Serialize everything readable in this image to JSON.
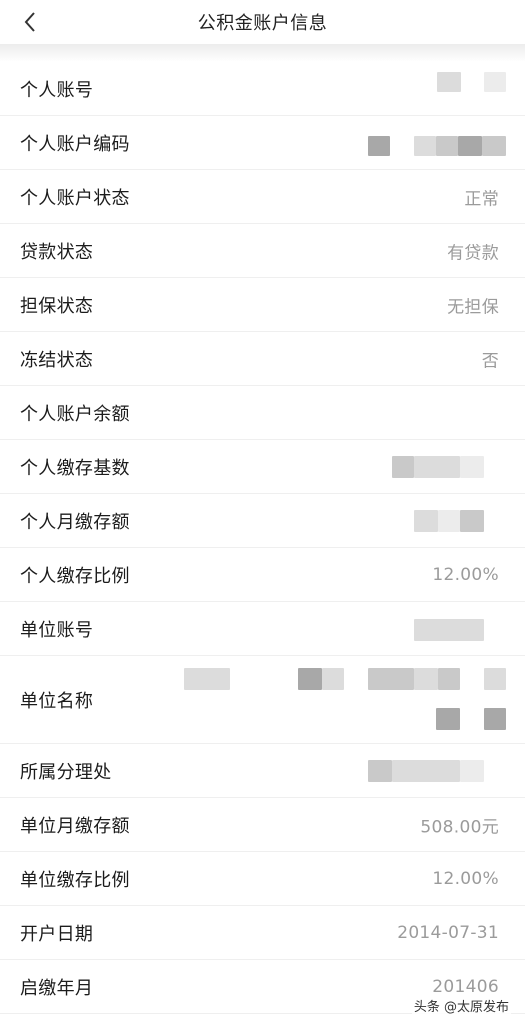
{
  "header": {
    "title": "公积金账户信息",
    "back_icon": "chevron-left-icon"
  },
  "rows": [
    {
      "label": "个人账号",
      "value": ""
    },
    {
      "label": "个人账户编码",
      "value": ""
    },
    {
      "label": "个人账户状态",
      "value": "正常"
    },
    {
      "label": "贷款状态",
      "value": "有贷款"
    },
    {
      "label": "担保状态",
      "value": "无担保"
    },
    {
      "label": "冻结状态",
      "value": "否"
    },
    {
      "label": "个人账户余额",
      "value": ""
    },
    {
      "label": "个人缴存基数",
      "value": ""
    },
    {
      "label": "个人月缴存额",
      "value": ""
    },
    {
      "label": "个人缴存比例",
      "value": "12.00%"
    },
    {
      "label": "单位账号",
      "value": ""
    },
    {
      "label": "单位名称",
      "value": ""
    },
    {
      "label": "所属分理处",
      "value": ""
    },
    {
      "label": "单位月缴存额",
      "value": "508.00元"
    },
    {
      "label": "单位缴存比例",
      "value": "12.00%"
    },
    {
      "label": "开户日期",
      "value": "2014-07-31"
    },
    {
      "label": "启缴年月",
      "value": "201406"
    }
  ],
  "watermark": "头条 @太原发布",
  "colors": {
    "label": "#1c1c1c",
    "value": "#9b9b9b",
    "divider": "#efefef"
  }
}
